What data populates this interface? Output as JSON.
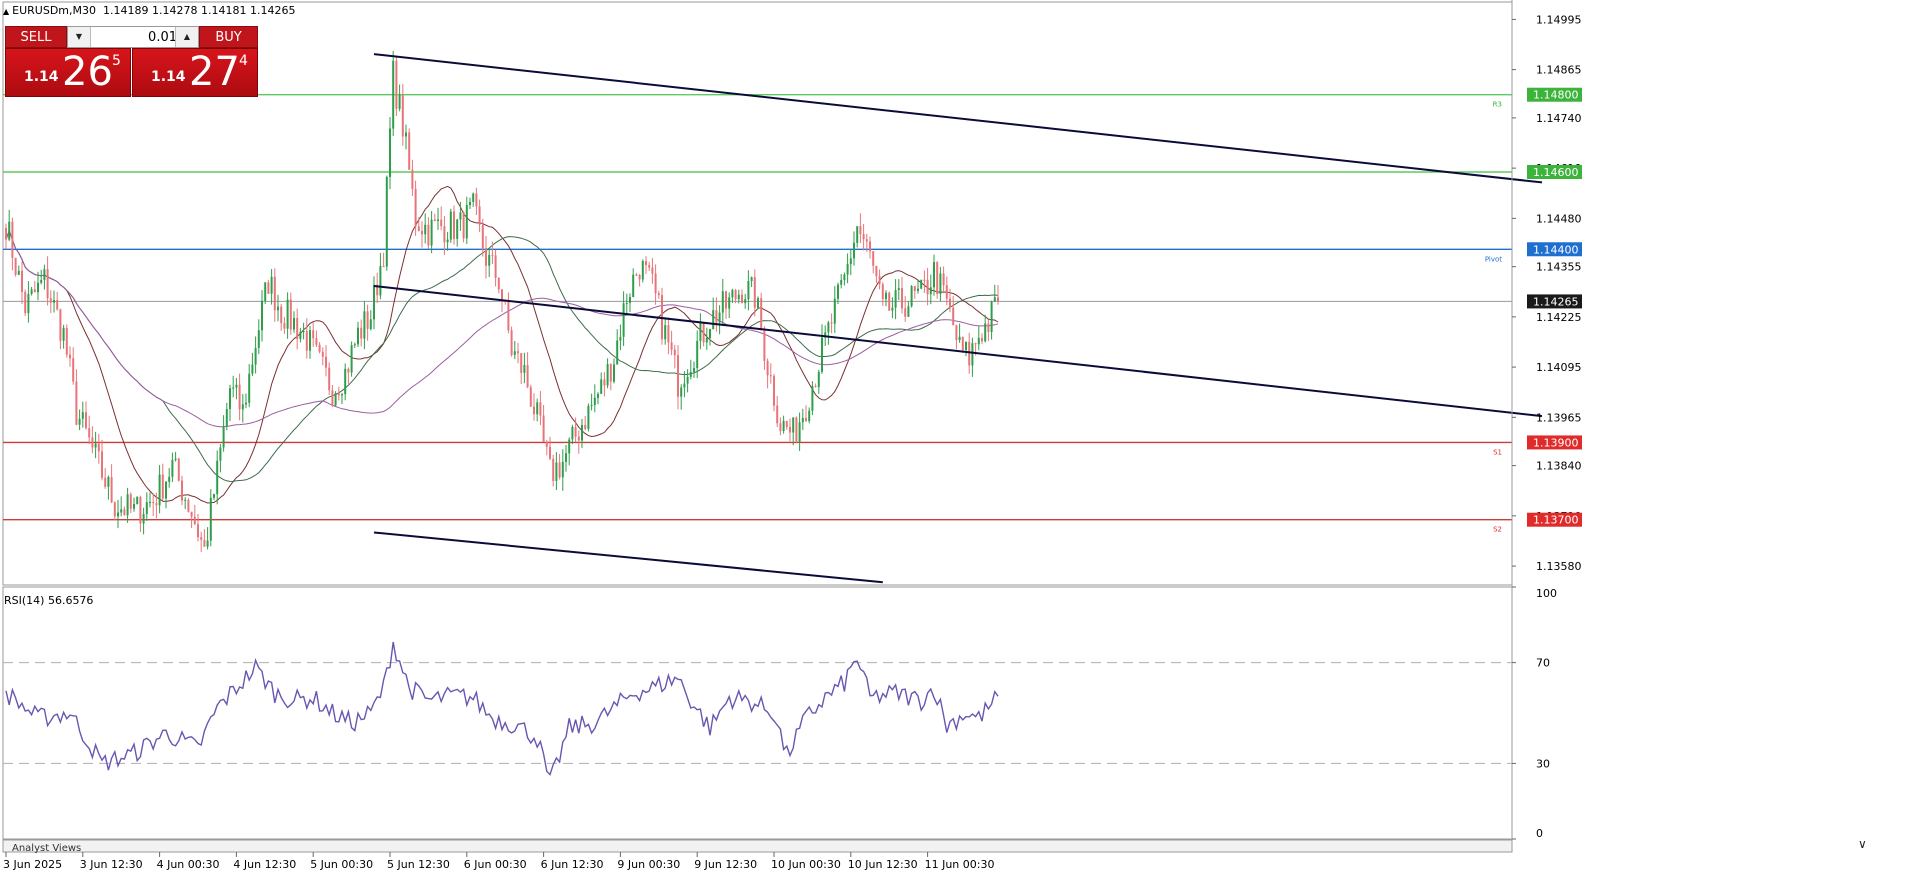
{
  "header": {
    "symbol": "EURUSDm,M30",
    "ohlc": "1.14189 1.14278 1.14181 1.14265"
  },
  "trade_panel": {
    "sell_label": "SELL",
    "buy_label": "BUY",
    "lot": "0.01",
    "sell_price": {
      "small": "1.14",
      "big": "26",
      "sup": "5"
    },
    "buy_price": {
      "small": "1.14",
      "big": "27",
      "sup": "4"
    }
  },
  "price_axis": {
    "ticks": [
      {
        "label": "1.14995",
        "value": 1.14995
      },
      {
        "label": "1.14865",
        "value": 1.14865
      },
      {
        "label": "1.14740",
        "value": 1.1474
      },
      {
        "label": "1.14610",
        "value": 1.1461
      },
      {
        "label": "1.14480",
        "value": 1.1448
      },
      {
        "label": "1.14355",
        "value": 1.14355
      },
      {
        "label": "1.14225",
        "value": 1.14225
      },
      {
        "label": "1.14095",
        "value": 1.14095
      },
      {
        "label": "1.13965",
        "value": 1.13965
      },
      {
        "label": "1.13840",
        "value": 1.1384
      },
      {
        "label": "1.13710",
        "value": 1.1371
      },
      {
        "label": "1.13580",
        "value": 1.1358
      }
    ],
    "min": 1.13531,
    "max": 1.1504
  },
  "levels": [
    {
      "label": "1.14800",
      "value": 1.148,
      "color": "#3cb43c",
      "tag": "R3",
      "tag_color": "#3cb43c",
      "line_color": "#5fca5f"
    },
    {
      "label": "1.14600",
      "value": 1.146,
      "color": "#3cb43c",
      "tag": "",
      "tag_color": "#3cb43c",
      "line_color": "#5fca5f"
    },
    {
      "label": "1.14400",
      "value": 1.144,
      "color": "#1f6fd1",
      "tag": "Pivot",
      "tag_color": "#1f6fd1",
      "line_color": "#1f6fd1"
    },
    {
      "label": "1.14265",
      "value": 1.14265,
      "color": "#1a1a1a",
      "tag": "",
      "tag_color": "#444",
      "line_color": "#9a9a9a"
    },
    {
      "label": "1.13900",
      "value": 1.139,
      "color": "#e02b2b",
      "tag": "S1",
      "tag_color": "#e02b2b",
      "line_color": "#cc3a3a"
    },
    {
      "label": "1.13700",
      "value": 1.137,
      "color": "#e02b2b",
      "tag": "S2",
      "tag_color": "#e02b2b",
      "line_color": "#cc3a3a"
    }
  ],
  "time_axis": {
    "labels": [
      "3 Jun 2025",
      "3 Jun 12:30",
      "4 Jun 00:30",
      "4 Jun 12:30",
      "5 Jun 00:30",
      "5 Jun 12:30",
      "6 Jun 00:30",
      "6 Jun 12:30",
      "9 Jun 00:30",
      "9 Jun 12:30",
      "10 Jun 00:30",
      "10 Jun 12:30",
      "11 Jun 00:30"
    ]
  },
  "rsi": {
    "title": "RSI(14) 56.6576",
    "ticks": [
      {
        "label": "100",
        "value": 100
      },
      {
        "label": "70",
        "value": 70
      },
      {
        "label": "30",
        "value": 30
      },
      {
        "label": "0",
        "value": 0
      }
    ]
  },
  "bottom_tab": "Analyst Views",
  "colors": {
    "bull": "#2e9e4a",
    "bear": "#e8747a",
    "ma_fast": "#7a3030",
    "ma_mid": "#3f6b4c",
    "ma_slow": "#9b5da1",
    "rsi_line": "#6a56b0",
    "channel": "#0b0b3a"
  },
  "chart_data": {
    "type": "candlestick",
    "symbol": "EURUSDm",
    "timeframe": "M30",
    "x_labels": [
      "3 Jun 2025",
      "3 Jun 12:30",
      "4 Jun 00:30",
      "4 Jun 12:30",
      "5 Jun 00:30",
      "5 Jun 12:30",
      "6 Jun 00:30",
      "6 Jun 12:30",
      "9 Jun 00:30",
      "9 Jun 12:30",
      "10 Jun 00:30",
      "10 Jun 12:30",
      "11 Jun 00:30"
    ],
    "ylim": [
      1.13531,
      1.1504
    ],
    "close_path": [
      [
        0,
        1.1447
      ],
      [
        6,
        1.1425
      ],
      [
        12,
        1.1432
      ],
      [
        18,
        1.1418
      ],
      [
        22,
        1.1398
      ],
      [
        28,
        1.1386
      ],
      [
        34,
        1.1374
      ],
      [
        40,
        1.1372
      ],
      [
        46,
        1.1375
      ],
      [
        52,
        1.1384
      ],
      [
        58,
        1.1372
      ],
      [
        62,
        1.1362
      ],
      [
        66,
        1.1382
      ],
      [
        70,
        1.1404
      ],
      [
        74,
        1.1398
      ],
      [
        78,
        1.1416
      ],
      [
        82,
        1.1432
      ],
      [
        86,
        1.1424
      ],
      [
        90,
        1.1421
      ],
      [
        94,
        1.1417
      ],
      [
        98,
        1.141
      ],
      [
        102,
        1.1404
      ],
      [
        106,
        1.1408
      ],
      [
        110,
        1.1418
      ],
      [
        114,
        1.1423
      ],
      [
        118,
        1.144
      ],
      [
        121,
        1.1485
      ],
      [
        124,
        1.1472
      ],
      [
        128,
        1.1448
      ],
      [
        132,
        1.1445
      ],
      [
        136,
        1.1446
      ],
      [
        142,
        1.1446
      ],
      [
        146,
        1.145
      ],
      [
        150,
        1.1438
      ],
      [
        154,
        1.1432
      ],
      [
        158,
        1.1414
      ],
      [
        162,
        1.1408
      ],
      [
        166,
        1.1396
      ],
      [
        170,
        1.1382
      ],
      [
        174,
        1.1385
      ],
      [
        180,
        1.1395
      ],
      [
        186,
        1.1404
      ],
      [
        190,
        1.1412
      ],
      [
        194,
        1.1428
      ],
      [
        198,
        1.1436
      ],
      [
        202,
        1.143
      ],
      [
        206,
        1.1418
      ],
      [
        210,
        1.1406
      ],
      [
        214,
        1.1412
      ],
      [
        220,
        1.1422
      ],
      [
        226,
        1.1426
      ],
      [
        230,
        1.143
      ],
      [
        234,
        1.1428
      ],
      [
        238,
        1.141
      ],
      [
        242,
        1.1395
      ],
      [
        246,
        1.1392
      ],
      [
        250,
        1.14
      ],
      [
        256,
        1.1416
      ],
      [
        262,
        1.1432
      ],
      [
        266,
        1.1446
      ],
      [
        270,
        1.1438
      ],
      [
        274,
        1.1424
      ],
      [
        280,
        1.1426
      ],
      [
        286,
        1.1428
      ],
      [
        290,
        1.1434
      ],
      [
        294,
        1.1426
      ],
      [
        298,
        1.1414
      ],
      [
        301,
        1.1412
      ],
      [
        304,
        1.1418
      ],
      [
        307,
        1.1421
      ],
      [
        310,
        1.14265
      ]
    ],
    "rsi_path": [
      [
        0,
        58
      ],
      [
        10,
        48
      ],
      [
        20,
        50
      ],
      [
        30,
        30
      ],
      [
        40,
        34
      ],
      [
        50,
        42
      ],
      [
        60,
        36
      ],
      [
        66,
        52
      ],
      [
        72,
        60
      ],
      [
        78,
        68
      ],
      [
        84,
        58
      ],
      [
        90,
        55
      ],
      [
        96,
        56
      ],
      [
        102,
        50
      ],
      [
        108,
        46
      ],
      [
        114,
        50
      ],
      [
        118,
        60
      ],
      [
        121,
        78
      ],
      [
        126,
        60
      ],
      [
        132,
        55
      ],
      [
        140,
        57
      ],
      [
        146,
        56
      ],
      [
        152,
        48
      ],
      [
        160,
        45
      ],
      [
        166,
        40
      ],
      [
        170,
        22
      ],
      [
        176,
        44
      ],
      [
        184,
        46
      ],
      [
        190,
        52
      ],
      [
        196,
        58
      ],
      [
        202,
        60
      ],
      [
        210,
        64
      ],
      [
        214,
        55
      ],
      [
        220,
        44
      ],
      [
        226,
        56
      ],
      [
        232,
        55
      ],
      [
        240,
        50
      ],
      [
        244,
        33
      ],
      [
        250,
        48
      ],
      [
        256,
        56
      ],
      [
        262,
        62
      ],
      [
        266,
        72
      ],
      [
        270,
        56
      ],
      [
        278,
        58
      ],
      [
        286,
        55
      ],
      [
        290,
        60
      ],
      [
        294,
        45
      ],
      [
        300,
        50
      ],
      [
        304,
        48
      ],
      [
        307,
        52
      ],
      [
        310,
        56.6576
      ]
    ],
    "channel_lines": [
      {
        "p1": [
          115,
          1.14905
        ],
        "p2": [
          480,
          1.14573
        ]
      },
      {
        "p1": [
          115,
          1.14305
        ],
        "p2": [
          480,
          1.13968
        ]
      },
      {
        "p1": [
          115,
          1.13667
        ],
        "p2": [
          274,
          1.13538
        ]
      }
    ]
  }
}
